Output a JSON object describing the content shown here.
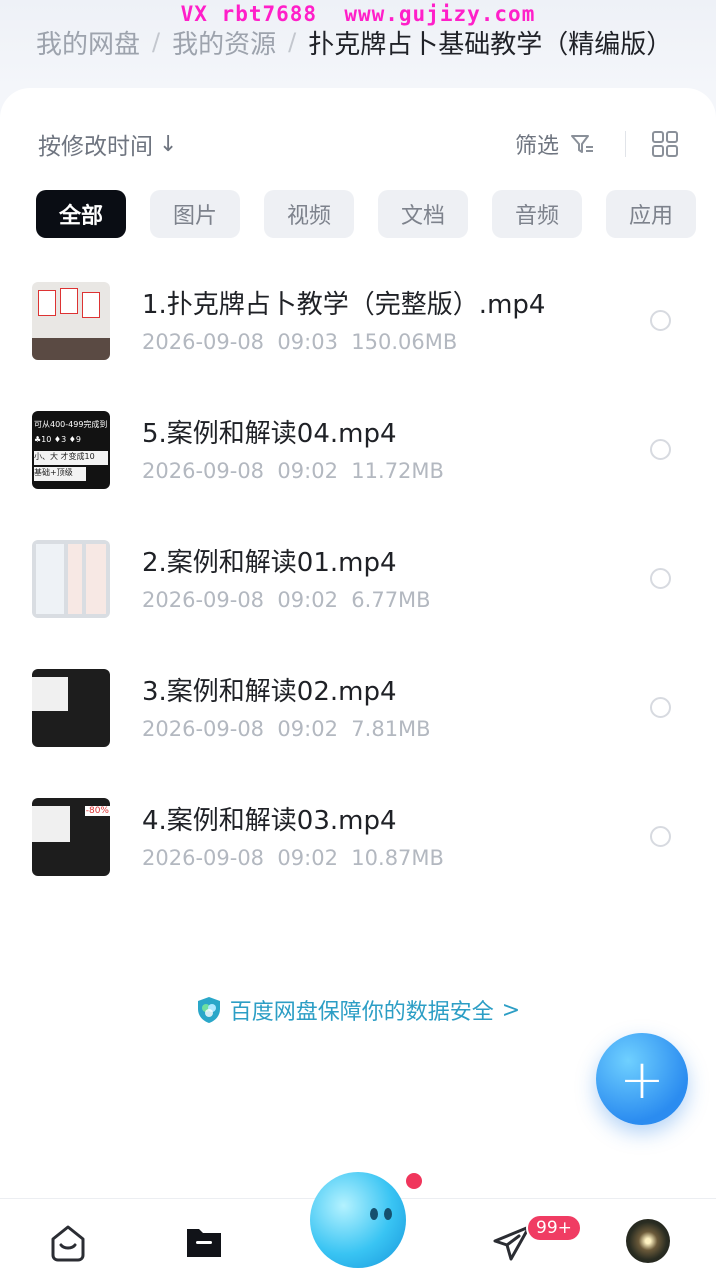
{
  "watermark": "VX rbt7688  www.gujizy.com",
  "breadcrumb": {
    "items": [
      "我的网盘",
      "我的资源"
    ],
    "current": "扑克牌占卜基础教学（精编版）",
    "separator": "/"
  },
  "toolbar": {
    "sort_label": "按修改时间",
    "sort_arrow": "↓",
    "filter_label": "筛选"
  },
  "categories": [
    "全部",
    "图片",
    "视频",
    "文档",
    "音频",
    "应用"
  ],
  "files": [
    {
      "name": "1.扑克牌占卜教学（完整版）.mp4",
      "date": "2026-09-08",
      "time": "09:03",
      "size": "150.06MB"
    },
    {
      "name": "5.案例和解读04.mp4",
      "date": "2026-09-08",
      "time": "09:02",
      "size": "11.72MB"
    },
    {
      "name": "2.案例和解读01.mp4",
      "date": "2026-09-08",
      "time": "09:02",
      "size": "6.77MB"
    },
    {
      "name": "3.案例和解读02.mp4",
      "date": "2026-09-08",
      "time": "09:02",
      "size": "7.81MB"
    },
    {
      "name": "4.案例和解读03.mp4",
      "date": "2026-09-08",
      "time": "09:02",
      "size": "10.87MB"
    }
  ],
  "thumb_text": {
    "t2_row1": "可从400-499完成到5",
    "t2_row2": "♣10 ♦3 ♦9",
    "t2_row3": "小、大  才变成10",
    "t2_row4": "基础+顶级",
    "t5_tag": "-80%"
  },
  "security_note": "百度网盘保障你的数据安全",
  "security_arrow": ">",
  "fab_label": "+",
  "nav": {
    "badge": "99+"
  },
  "colors": {
    "accent": "#2c9ec5",
    "badge": "#f03c63",
    "fab": "#2b8cf0",
    "active_chip": "#0a0d14"
  }
}
